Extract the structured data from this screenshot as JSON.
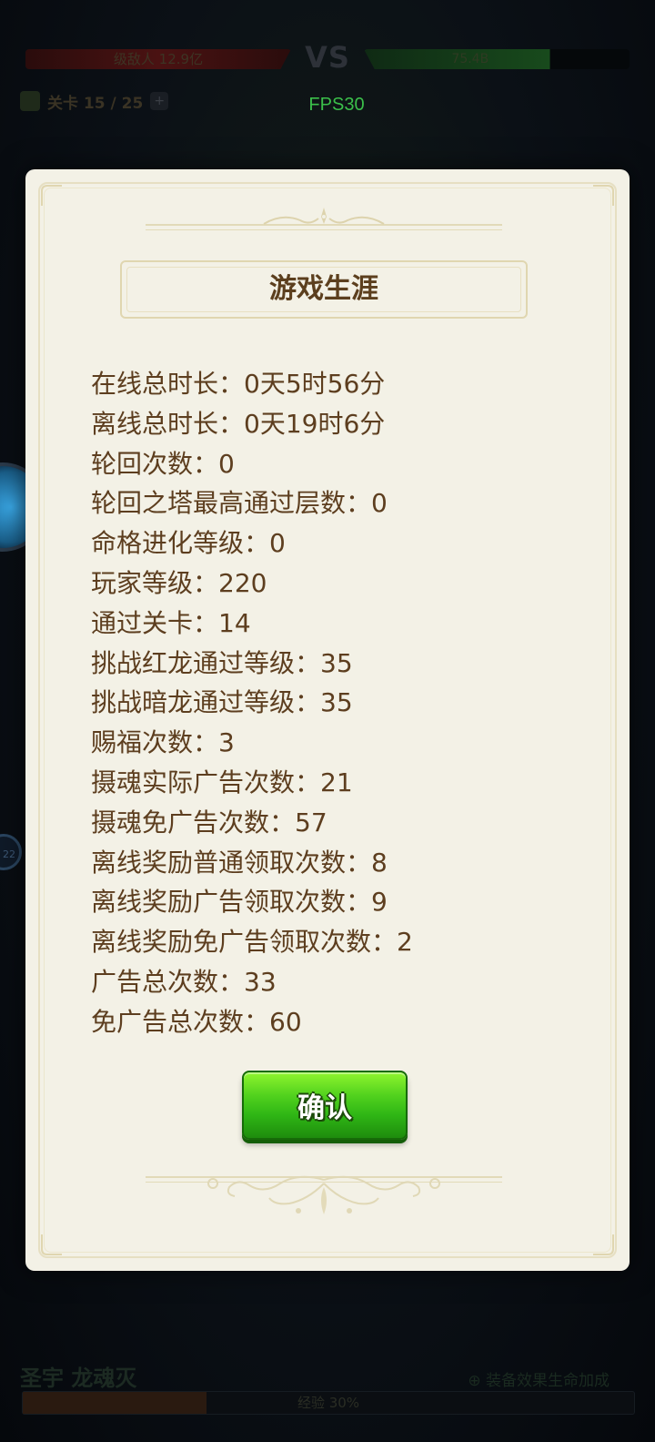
{
  "background_hud": {
    "enemy_hp_label": "级敌人 12.9亿",
    "vs_label": "VS",
    "player_hp_label": "75.4B",
    "level_label": "关卡 15 / 25",
    "fps_label": "FPS30",
    "left_badge_count": "22",
    "bottom_name": "圣宇 龙魂灭",
    "bottom_right_label": "⊕ 装备效果生命加成",
    "bottom_bar_label": "经验 30%",
    "bottom_bar_progress": 0.3
  },
  "dialog": {
    "title": "游戏生涯",
    "separator": "：",
    "stats": [
      {
        "label": "在线总时长",
        "value": "0天5时56分"
      },
      {
        "label": "离线总时长",
        "value": "0天19时6分"
      },
      {
        "label": "轮回次数",
        "value": "0"
      },
      {
        "label": "轮回之塔最高通过层数",
        "value": "0"
      },
      {
        "label": "命格进化等级",
        "value": "0"
      },
      {
        "label": "玩家等级",
        "value": "220"
      },
      {
        "label": "通过关卡",
        "value": "14"
      },
      {
        "label": "挑战红龙通过等级",
        "value": "35"
      },
      {
        "label": "挑战暗龙通过等级",
        "value": "35"
      },
      {
        "label": "赐福次数",
        "value": "3"
      },
      {
        "label": "摄魂实际广告次数",
        "value": "21"
      },
      {
        "label": "摄魂免广告次数",
        "value": "57"
      },
      {
        "label": "离线奖励普通领取次数",
        "value": "8"
      },
      {
        "label": "离线奖励广告领取次数",
        "value": "9"
      },
      {
        "label": "离线奖励免广告领取次数",
        "value": "2"
      },
      {
        "label": "广告总次数",
        "value": "33"
      },
      {
        "label": "免广告总次数",
        "value": "60"
      }
    ],
    "confirm_label": "确认"
  },
  "colors": {
    "dialog_background": "#f3f1e6",
    "stat_text": "#5d3e1f",
    "confirm_button": "#3cc11a",
    "fps_text": "#3bbf4a"
  }
}
